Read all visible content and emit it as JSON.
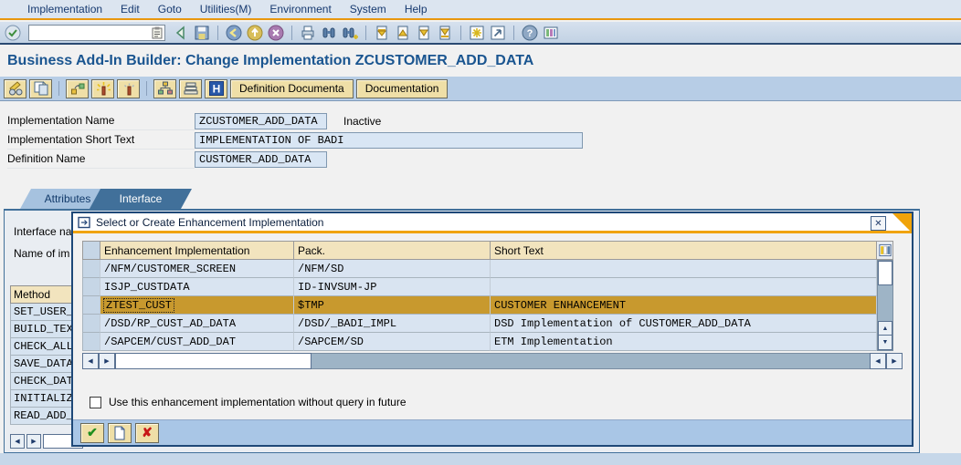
{
  "menu_bar": {
    "items": [
      "Implementation",
      "Edit",
      "Goto",
      "Utilities(M)",
      "Environment",
      "System",
      "Help"
    ]
  },
  "system_toolbar": {
    "command_field_value": ""
  },
  "page_title": "Business Add-In Builder: Change Implementation ZCUSTOMER_ADD_DATA",
  "app_toolbar": {
    "buttons": [
      {
        "label": "Definition Documenta"
      },
      {
        "label": "Documentation"
      }
    ]
  },
  "form": {
    "rows": [
      {
        "label": "Implementation Name",
        "value": "ZCUSTOMER_ADD_DATA",
        "status": "Inactive"
      },
      {
        "label": "Implementation Short Text",
        "value": "IMPLEMENTATION OF BADI"
      },
      {
        "label": "Definition Name",
        "value": "CUSTOMER_ADD_DATA"
      }
    ]
  },
  "tabs": [
    {
      "label": "Attributes",
      "active": false
    },
    {
      "label": "Interface",
      "active": true
    }
  ],
  "panel": {
    "field_labels": [
      "Interface na",
      "Name of im"
    ],
    "method_table": {
      "header": "Method",
      "rows": [
        "SET_USER_",
        "BUILD_TEXT",
        "CHECK_ALL_",
        "SAVE_DATA",
        "CHECK_DATA",
        "INITIALIZE",
        "READ_ADD_"
      ]
    }
  },
  "dialog": {
    "title": "Select or Create Enhancement Implementation",
    "table": {
      "columns": [
        "Enhancement Implementation",
        "Pack.",
        "Short Text"
      ],
      "rows": [
        {
          "impl": "/NFM/CUSTOMER_SCREEN",
          "pack": "/NFM/SD",
          "short_text": "",
          "selected": false
        },
        {
          "impl": "ISJP_CUSTDATA",
          "pack": "ID-INVSUM-JP",
          "short_text": "",
          "selected": false
        },
        {
          "impl": "ZTEST_CUST",
          "pack": "$TMP",
          "short_text": "CUSTOMER ENHANCEMENT",
          "selected": true
        },
        {
          "impl": "/DSD/RP_CUST_AD_DATA",
          "pack": "/DSD/_BADI_IMPL",
          "short_text": "DSD Implementation of CUSTOMER_ADD_DATA",
          "selected": false
        },
        {
          "impl": "/SAPCEM/CUST_ADD_DAT",
          "pack": "/SAPCEM/SD",
          "short_text": "ETM Implementation",
          "selected": false
        }
      ]
    },
    "checkbox": {
      "label": "Use this enhancement implementation without query in future",
      "checked": false
    }
  },
  "icons": {
    "enter_check": "✔",
    "close_x": "✕",
    "confirm_check": "✔",
    "cancel_x": "✘",
    "arrow_left": "◀",
    "arrow_right": "▶",
    "arrow_up": "▲",
    "arrow_down": "▼"
  },
  "colors": {
    "accent_orange": "#F0A30A",
    "selected_row_bg": "#C8992E",
    "table_header_bg": "#F2E4BE",
    "row_bg": "#D9E4F1",
    "button_bg": "#EFDFA7",
    "title_text": "#1A5590",
    "active_tab_bg": "#41709A",
    "dialog_border": "#1E4878",
    "app_toolbar_bg": "#B7CDE6",
    "button_bar_bg": "#A9C6E6"
  }
}
